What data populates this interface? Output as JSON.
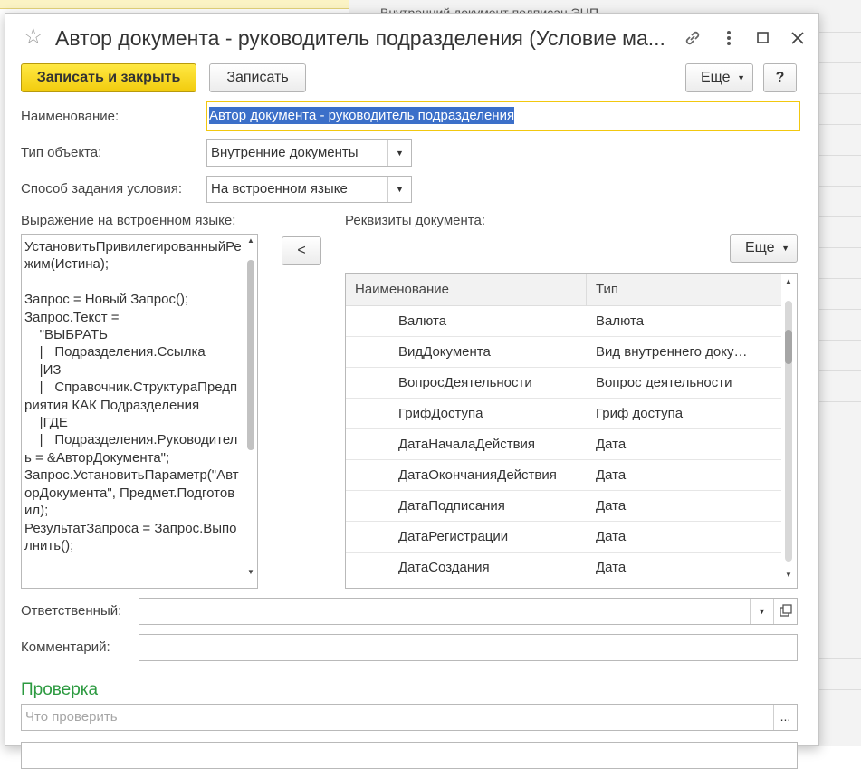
{
  "background": {
    "title_fragment": "Внутренний документ подписан ЭЦП"
  },
  "dialog": {
    "title": "Автор документа - руководитель подразделения (Условие ма...",
    "toolbar": {
      "save_close_label": "Записать и закрыть",
      "save_label": "Записать",
      "more_label": "Еще",
      "help_label": "?"
    },
    "form": {
      "name_label": "Наименование:",
      "name_value": "Автор документа - руководитель подразделения",
      "object_type_label": "Тип объекта:",
      "object_type_value": "Внутренние документы",
      "method_label": "Способ задания условия:",
      "method_value": "На встроенном языке",
      "expression_label": "Выражение на встроенном языке:",
      "expression_text": "УстановитьПривилегированныйРежим(Истина);\n\nЗапрос = Новый Запрос();\nЗапрос.Текст =\n\t\"ВЫБРАТЬ\n\t|\tПодразделения.Ссылка\n\t|ИЗ\n\t|\tСправочник.СтруктураПредприятия КАК Подразделения\n\t|ГДЕ\n\t|\tПодразделения.Руководитель = &АвторДокумента\";\nЗапрос.УстановитьПараметр(\"АвторДокумента\", Предмет.Подготовил);\nРезультатЗапроса = Запрос.Выполнить();",
      "move_button_label": "<",
      "attributes_label": "Реквизиты документа:",
      "attributes_more_label": "Еще",
      "responsible_label": "Ответственный:",
      "responsible_value": "",
      "comment_label": "Комментарий:",
      "comment_value": ""
    },
    "attributes_table": {
      "columns": [
        "Наименование",
        "Тип"
      ],
      "rows": [
        {
          "name": "Валюта",
          "type": "Валюта"
        },
        {
          "name": "ВидДокумента",
          "type": "Вид внутреннего доку…"
        },
        {
          "name": "ВопросДеятельности",
          "type": "Вопрос деятельности"
        },
        {
          "name": "ГрифДоступа",
          "type": "Гриф доступа"
        },
        {
          "name": "ДатаНачалаДействия",
          "type": "Дата"
        },
        {
          "name": "ДатаОкончанияДействия",
          "type": "Дата"
        },
        {
          "name": "ДатаПодписания",
          "type": "Дата"
        },
        {
          "name": "ДатаРегистрации",
          "type": "Дата"
        },
        {
          "name": "ДатаСоздания",
          "type": "Дата"
        }
      ]
    },
    "check_section": {
      "title": "Проверка",
      "what_to_check_placeholder": "Что проверить",
      "select_button_label": "..."
    }
  },
  "colors": {
    "primary_button": "#f2cc0e",
    "section_title": "#2c9a40",
    "selection": "#3b6fc9",
    "focus_border": "#f2c80f"
  }
}
